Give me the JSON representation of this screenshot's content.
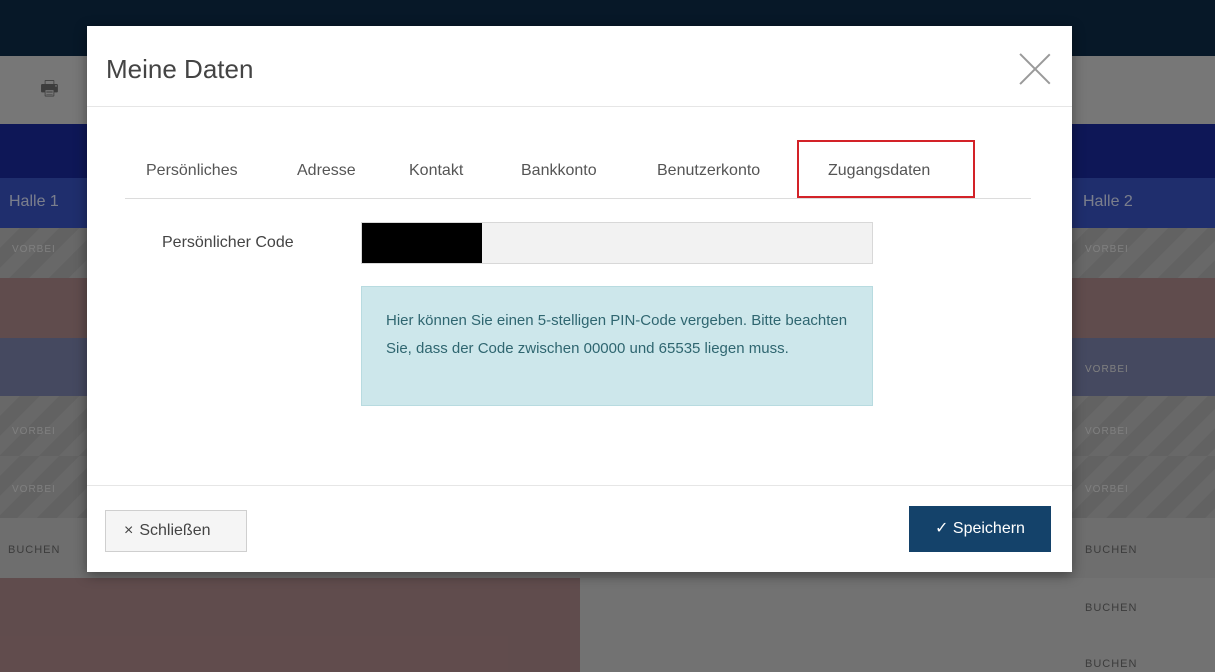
{
  "background": {
    "hall_left": "Halle 1",
    "hall_right": "Halle 2",
    "status_vorbei": "VORBEI",
    "status_buchen": "BUCHEN"
  },
  "modal": {
    "title": "Meine Daten",
    "tabs": [
      {
        "label": "Persönliches"
      },
      {
        "label": "Adresse"
      },
      {
        "label": "Kontakt"
      },
      {
        "label": "Bankkonto"
      },
      {
        "label": "Benutzerkonto"
      },
      {
        "label": "Zugangsdaten",
        "active": true
      }
    ],
    "code_label": "Persönlicher Code",
    "info_text": "Hier können Sie einen 5-stelligen PIN-Code vergeben. Bitte beachten Sie, dass der Code zwischen 00000 und 65535 liegen muss.",
    "close_label": "Schließen",
    "save_label": "Speichern",
    "close_icon": "×",
    "save_icon": "✓"
  }
}
